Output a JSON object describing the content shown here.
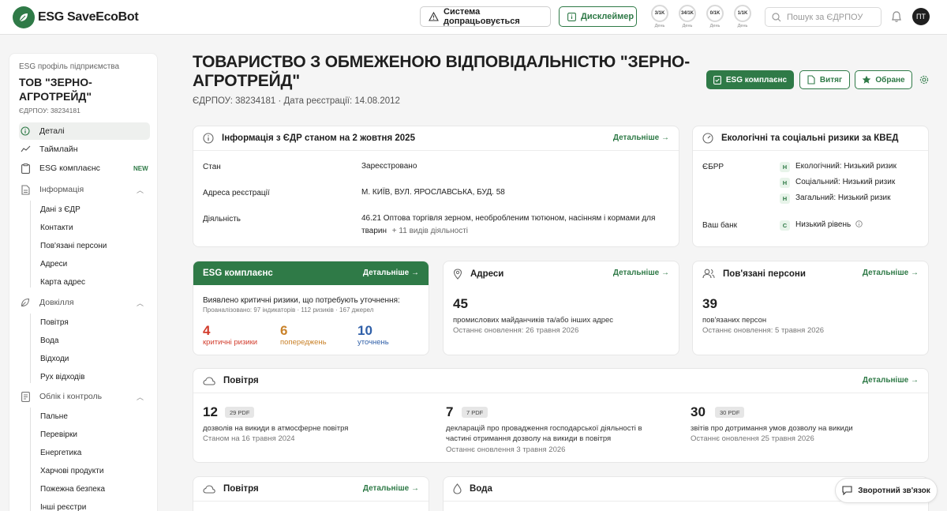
{
  "header": {
    "brand": "ESG SaveEcoBot",
    "improving_label": "Система допрацьовується",
    "disclaimer_label": "Дисклеймер",
    "meters": [
      {
        "value": "3/1K",
        "caption": "День"
      },
      {
        "value": "34/1K",
        "caption": "День"
      },
      {
        "value": "0/1K",
        "caption": "День"
      },
      {
        "value": "1/1K",
        "caption": "День"
      }
    ],
    "search_placeholder": "Пошук за ЄДРПОУ",
    "avatar_initials": "ПТ"
  },
  "sidebar": {
    "caption": "ESG профіль підприємства",
    "company": "ТОВ \"ЗЕРНО-АГРОТРЕЙД\"",
    "code": "ЄДРПОУ: 38234181",
    "items": [
      {
        "label": "Деталі",
        "icon": "info-icon"
      },
      {
        "label": "Таймлайн",
        "icon": "timeline-icon"
      },
      {
        "label": "ESG комплаєнс",
        "icon": "clipboard-icon",
        "badge": "NEW"
      }
    ],
    "groups": [
      {
        "label": "Інформація",
        "icon": "document-icon",
        "children": [
          "Дані з ЄДР",
          "Контакти",
          "Пов'язані персони",
          "Адреси",
          "Карта адрес"
        ]
      },
      {
        "label": "Довкілля",
        "icon": "leaf-icon",
        "children": [
          "Повітря",
          "Вода",
          "Відходи",
          "Рух відходів"
        ]
      },
      {
        "label": "Облік і контроль",
        "icon": "ledger-icon",
        "children": [
          "Пальне",
          "Перевірки",
          "Енергетика",
          "Харчові продукти",
          "Пожежна безпека",
          "Інші реєстри"
        ]
      }
    ]
  },
  "company": {
    "title": "ТОВАРИСТВО З ОБМЕЖЕНОЮ ВІДПОВІДАЛЬНІСТЮ \"ЗЕРНО-АГРОТРЕЙД\"",
    "meta": "ЄДРПОУ: 38234181  ·  Дата реєстрації: 14.08.2012",
    "actions": {
      "esg": "ESG комплаєнс",
      "extract": "Витяг",
      "favorite": "Обране"
    }
  },
  "edr": {
    "title": "Інформація з ЄДР станом на 2 жовтня 2025",
    "more": "Детальніше",
    "rows": [
      {
        "label": "Стан",
        "value": "Зареєстровано"
      },
      {
        "label": "Адреса реєстрації",
        "value": "М. КИЇВ, ВУЛ. ЯРОСЛАВСЬКА, БУД. 58"
      },
      {
        "label": "Діяльність",
        "value": "46.21 Оптова торгівля зерном, необробленим тютюном, насінням і кормами для тварин",
        "extra": "+ 11 видів діяльності"
      }
    ]
  },
  "risks": {
    "title": "Екологічні та соціальні ризики за КВЕД",
    "ebrd_label": "ЄБРР",
    "ebrd": [
      {
        "badge": "Н",
        "text": "Екологічний: Низький ризик"
      },
      {
        "badge": "Н",
        "text": "Соціальний: Низький ризик"
      },
      {
        "badge": "Н",
        "text": "Загальний: Низький ризик"
      }
    ],
    "bank_label": "Ваш банк",
    "bank": {
      "badge": "С",
      "text": "Низький рівень"
    }
  },
  "esg_card": {
    "title": "ESG комплаєнс",
    "more": "Детальніше",
    "headline": "Виявлено критичні ризики, що потребують уточнення:",
    "analyzed": "Проаналізовано: 97 індикаторів · 112 ризиків · 167 джерел",
    "stats": [
      {
        "value": "4",
        "label": "критичні ризики",
        "color": "#d23c2c"
      },
      {
        "value": "6",
        "label": "попереджень",
        "color": "#c9822a"
      },
      {
        "value": "10",
        "label": "уточнень",
        "color": "#2f5fa8"
      }
    ]
  },
  "addresses": {
    "title": "Адреси",
    "more": "Детальніше",
    "count": "45",
    "label": "промислових майданчиків та/або інших адрес",
    "updated": "Останнє оновлення: 26 травня 2026"
  },
  "persons": {
    "title": "Пов'язані персони",
    "more": "Детальніше",
    "count": "39",
    "label": "пов'язаних персон",
    "updated": "Останнє оновлення: 5 травня 2026"
  },
  "air": {
    "title": "Повітря",
    "more": "Детальніше",
    "items": [
      {
        "count": "12",
        "pdf": "29 PDF",
        "label": "дозволів на викиди в атмосферне повітря",
        "date": "Станом на 16 травня 2024"
      },
      {
        "count": "7",
        "pdf": "7 PDF",
        "label": "декларацій про провадження господарської діяльності в частині отримання дозволу на викиди в повітря",
        "date": "Останнє оновлення 3 травня 2026"
      },
      {
        "count": "30",
        "pdf": "30 PDF",
        "label": "звітів про дотримання умов дозволу на викиди",
        "date": "Останнє оновлення 25 травня 2026"
      }
    ]
  },
  "air2": {
    "title": "Повітря",
    "more": "Детальніше"
  },
  "water": {
    "title": "Вода"
  },
  "feedback_label": "Зворотний зв'язок",
  "colors": {
    "accent": "#2f7a47",
    "critical": "#d23c2c",
    "warning": "#c9822a",
    "clarify": "#2f5fa8"
  }
}
